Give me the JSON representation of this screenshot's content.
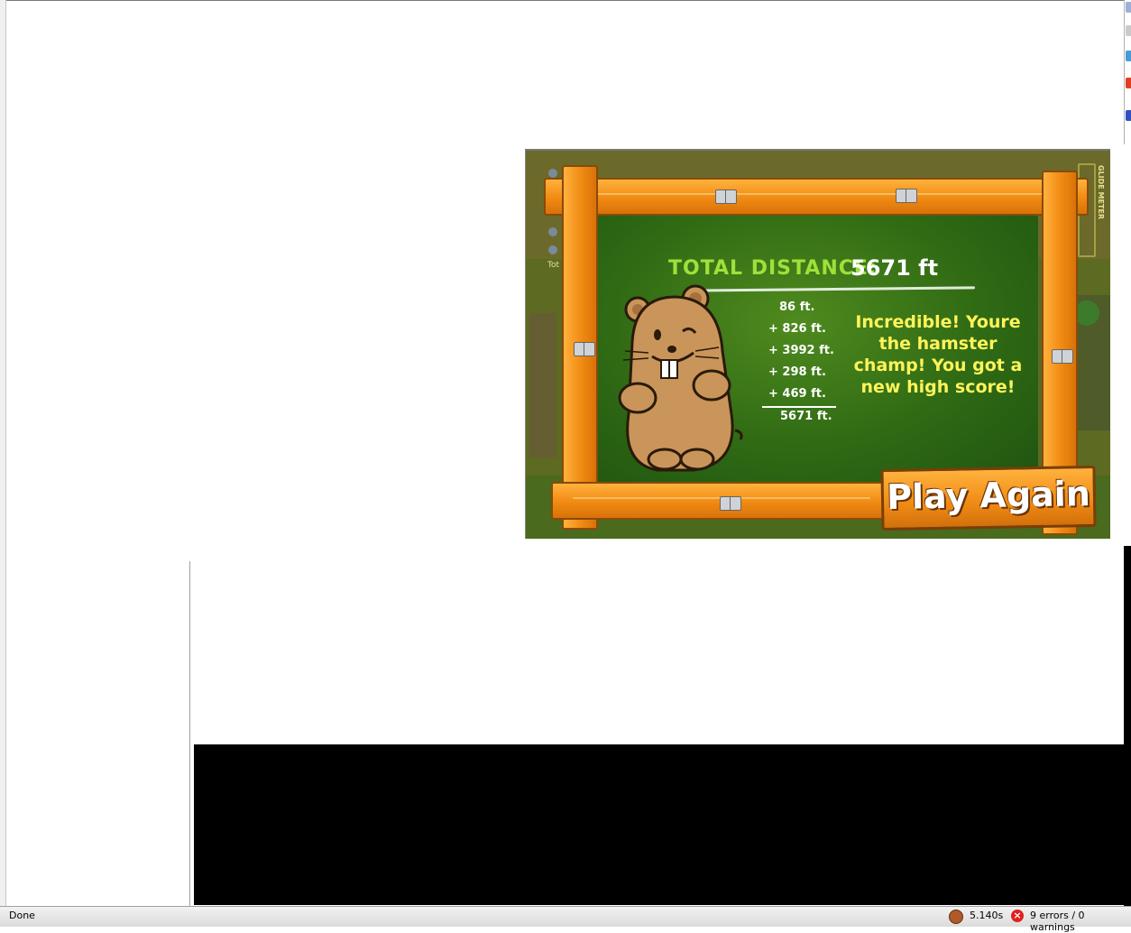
{
  "game": {
    "total_label": "TOTAL DISTANCE:",
    "total_value": "5671 ft",
    "distances": [
      "86 ft.",
      "+ 826 ft.",
      "+ 3992 ft.",
      "+ 298 ft.",
      "+ 469 ft."
    ],
    "sum": "5671 ft.",
    "message": "Incredible!  Youre the hamster champ! You got a new high score!",
    "play_again_label": "Play Again",
    "glide_meter_label": "GLIDE METER",
    "tot_label": "Tot"
  },
  "status_bar": {
    "status": "Done",
    "timer": "5.140s",
    "errors": "9 errors / 0 warnings"
  },
  "colors": {
    "chalkboard": "#2f6a14",
    "wood": "#f08a12",
    "title_green": "#9fe03a",
    "message_yellow": "#fff35a",
    "error_red": "#e02020"
  },
  "icons": {
    "timer": "stopwatch-icon",
    "error": "error-x-icon"
  }
}
